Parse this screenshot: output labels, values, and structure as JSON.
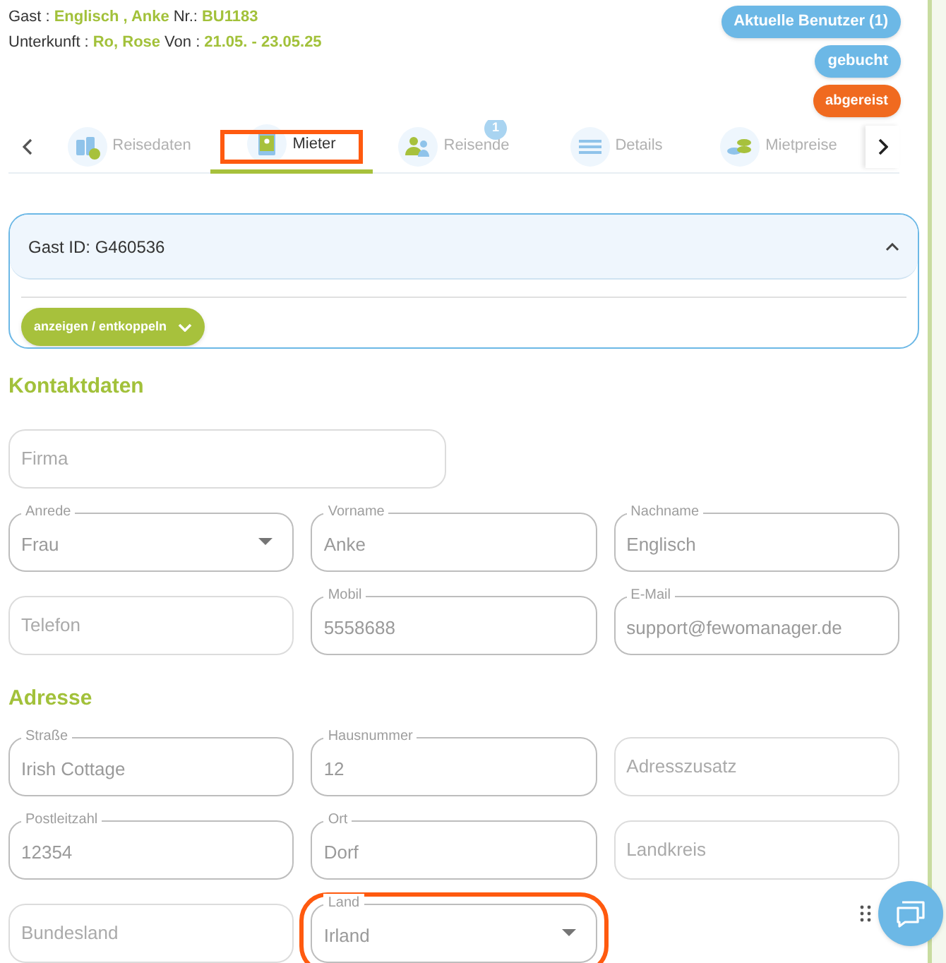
{
  "header": {
    "lines": [
      [
        {
          "label": "Gast :",
          "value": "Englisch , Anke"
        },
        {
          "label": "Nr.:",
          "value": "BU1183"
        }
      ],
      [
        {
          "label": "Unterkunft :",
          "value": "Ro, Rose"
        },
        {
          "label": "Von :",
          "value": "21.05. - 23.05.25"
        }
      ]
    ],
    "badges": [
      {
        "text": "Aktuelle Benutzer (1)",
        "color": "#6cb8e6"
      },
      {
        "text": "gebucht",
        "color": "#6cb8e6"
      },
      {
        "text": "abgereist",
        "color": "#f06a1f"
      }
    ]
  },
  "tabs": [
    {
      "label": "Reisedaten",
      "selected": false,
      "highlight": false
    },
    {
      "label": "Mieter",
      "selected": true,
      "highlight": true
    },
    {
      "label": "Reisende",
      "selected": false,
      "highlight": false,
      "badge": "1"
    },
    {
      "label": "Details",
      "selected": false,
      "highlight": false
    },
    {
      "label": "Mietpreise",
      "selected": false,
      "highlight": false
    }
  ],
  "guest_panel": {
    "title": "Gast ID: G460536",
    "expanded": true,
    "button": "anzeigen / entkoppeln"
  },
  "sections": [
    {
      "title": "Kontaktdaten",
      "rows": [
        [
          {
            "kind": "text",
            "placeholder": "Firma"
          }
        ],
        [
          {
            "kind": "select",
            "label": "Anrede",
            "value": "Frau"
          },
          {
            "kind": "text",
            "label": "Vorname",
            "value": "Anke"
          },
          {
            "kind": "text",
            "label": "Nachname",
            "value": "Englisch"
          }
        ],
        [
          {
            "kind": "text",
            "placeholder": "Telefon"
          },
          {
            "kind": "text",
            "label": "Mobil",
            "value": "5558688"
          },
          {
            "kind": "text",
            "label": "E-Mail",
            "value": "support@fewomanager.de"
          }
        ]
      ]
    },
    {
      "title": "Adresse",
      "rows": [
        [
          {
            "kind": "text",
            "label": "Straße",
            "value": "Irish Cottage"
          },
          {
            "kind": "text",
            "label": "Hausnummer",
            "value": "12"
          },
          {
            "kind": "text",
            "placeholder": "Adresszusatz"
          }
        ],
        [
          {
            "kind": "text",
            "label": "Postleitzahl",
            "value": "12354"
          },
          {
            "kind": "text",
            "label": "Ort",
            "value": "Dorf"
          },
          {
            "kind": "text",
            "placeholder": "Landkreis"
          }
        ],
        [
          {
            "kind": "text",
            "placeholder": "Bundesland"
          },
          {
            "kind": "select",
            "label": "Land",
            "value": "Irland",
            "highlight": true
          }
        ]
      ]
    }
  ]
}
